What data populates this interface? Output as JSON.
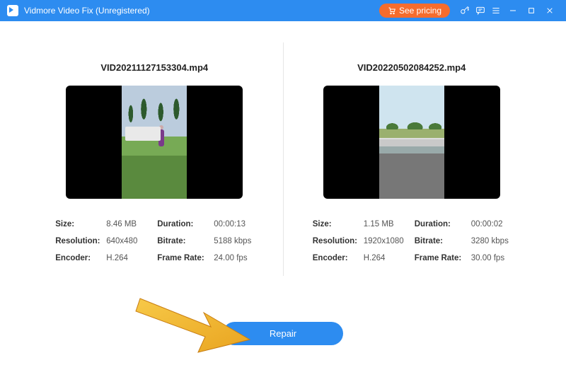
{
  "header": {
    "title": "Vidmore Video Fix (Unregistered)",
    "see_pricing": "See pricing"
  },
  "left": {
    "filename": "VID20211127153304.mp4",
    "meta": {
      "size_label": "Size:",
      "size": "8.46 MB",
      "duration_label": "Duration:",
      "duration": "00:00:13",
      "res_label": "Resolution:",
      "res": "640x480",
      "bitrate_label": "Bitrate:",
      "bitrate": "5188 kbps",
      "enc_label": "Encoder:",
      "enc": "H.264",
      "fps_label": "Frame Rate:",
      "fps": "24.00 fps"
    }
  },
  "right": {
    "filename": "VID20220502084252.mp4",
    "meta": {
      "size_label": "Size:",
      "size": "1.15 MB",
      "duration_label": "Duration:",
      "duration": "00:00:02",
      "res_label": "Resolution:",
      "res": "1920x1080",
      "bitrate_label": "Bitrate:",
      "bitrate": "3280 kbps",
      "enc_label": "Encoder:",
      "enc": "H.264",
      "fps_label": "Frame Rate:",
      "fps": "30.00 fps"
    }
  },
  "actions": {
    "repair": "Repair"
  }
}
